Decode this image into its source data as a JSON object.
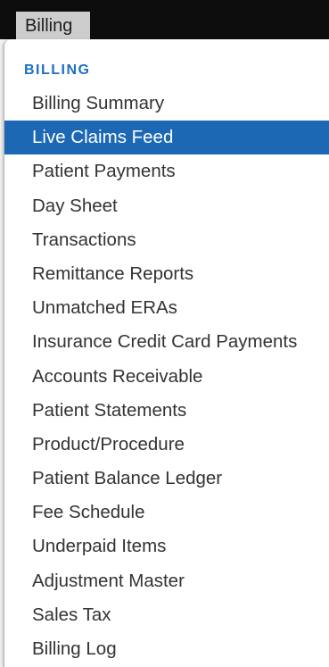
{
  "topbar": {
    "tab_label": "Billing"
  },
  "menu": {
    "section_title": "BILLING",
    "items": [
      {
        "label": "Billing Summary",
        "selected": false
      },
      {
        "label": "Live Claims Feed",
        "selected": true
      },
      {
        "label": "Patient Payments",
        "selected": false
      },
      {
        "label": "Day Sheet",
        "selected": false
      },
      {
        "label": "Transactions",
        "selected": false
      },
      {
        "label": "Remittance Reports",
        "selected": false
      },
      {
        "label": "Unmatched ERAs",
        "selected": false
      },
      {
        "label": "Insurance Credit Card Payments",
        "selected": false
      },
      {
        "label": "Accounts Receivable",
        "selected": false
      },
      {
        "label": "Patient Statements",
        "selected": false
      },
      {
        "label": "Product/Procedure",
        "selected": false
      },
      {
        "label": "Patient Balance Ledger",
        "selected": false
      },
      {
        "label": "Fee Schedule",
        "selected": false
      },
      {
        "label": "Underpaid Items",
        "selected": false
      },
      {
        "label": "Adjustment Master",
        "selected": false
      },
      {
        "label": "Sales Tax",
        "selected": false
      },
      {
        "label": "Billing Log",
        "selected": false
      }
    ]
  },
  "colors": {
    "topbar-bg": "#0d0d0d",
    "tab-bg": "#cdcdcd",
    "tab-text": "#1e1e1e",
    "section-color": "#1b6fc6",
    "item-text": "#333333",
    "selected-bg": "#1c68b4",
    "selected-text": "#ffffff",
    "panel-bg": "#ffffff"
  }
}
